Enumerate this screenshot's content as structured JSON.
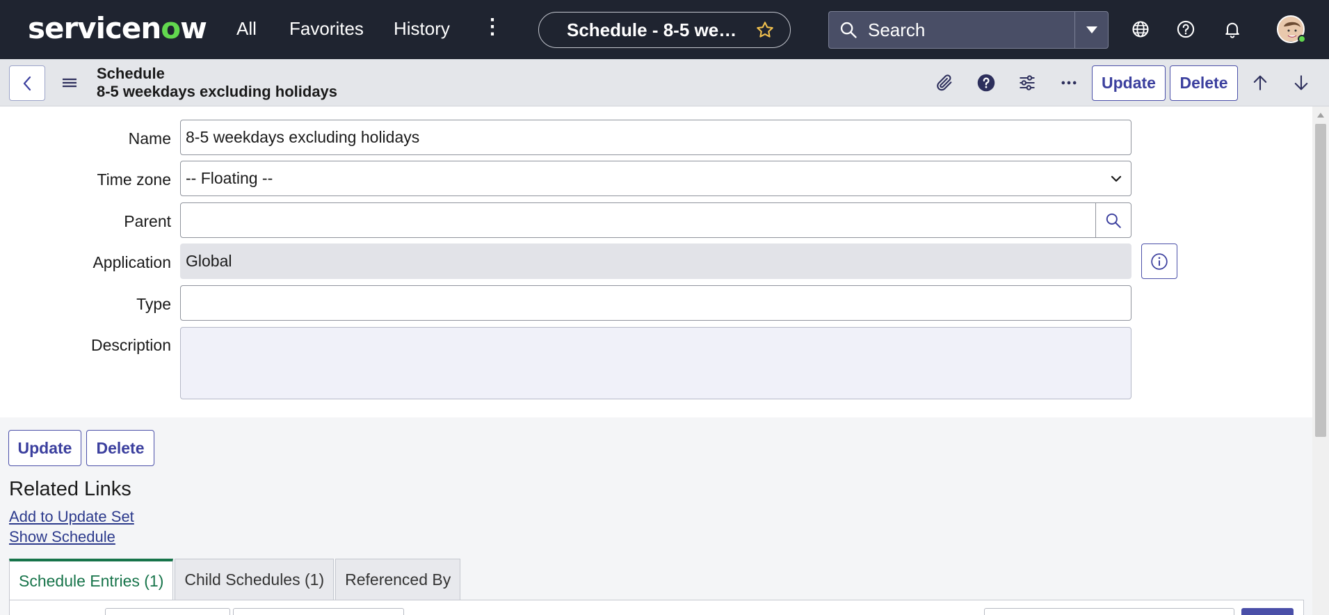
{
  "topnav": {
    "logo": "servicenow",
    "links": [
      "All",
      "Favorites",
      "History"
    ],
    "context_pill": "Schedule - 8-5 weekdays excluding holidays",
    "search_placeholder": "Search",
    "icons": [
      "globe-icon",
      "help-circle-icon",
      "bell-icon",
      "avatar"
    ],
    "brand_color": "#62d84e"
  },
  "header": {
    "title": "Schedule",
    "subtitle": "8-5 weekdays excluding holidays",
    "update_label": "Update",
    "delete_label": "Delete"
  },
  "form": {
    "fields": [
      {
        "label": "Name",
        "value": "8-5 weekdays excluding holidays"
      },
      {
        "label": "Time zone",
        "value": "-- Floating --"
      },
      {
        "label": "Parent",
        "value": ""
      },
      {
        "label": "Application",
        "value": "Global"
      },
      {
        "label": "Type",
        "value": ""
      },
      {
        "label": "Description",
        "value": ""
      }
    ]
  },
  "bottom": {
    "update_label": "Update",
    "delete_label": "Delete"
  },
  "related_links": {
    "title": "Related Links",
    "links": [
      "Add to Update Set",
      "Show Schedule"
    ]
  },
  "tabs": [
    {
      "label": "Schedule Entries (1)",
      "active": true
    },
    {
      "label": "Child Schedules (1)",
      "active": false
    },
    {
      "label": "Referenced By",
      "active": false
    }
  ],
  "colors": {
    "topnav_bg": "#1f2430",
    "accent": "#3b3f9e",
    "active_tab": "#17744a"
  }
}
